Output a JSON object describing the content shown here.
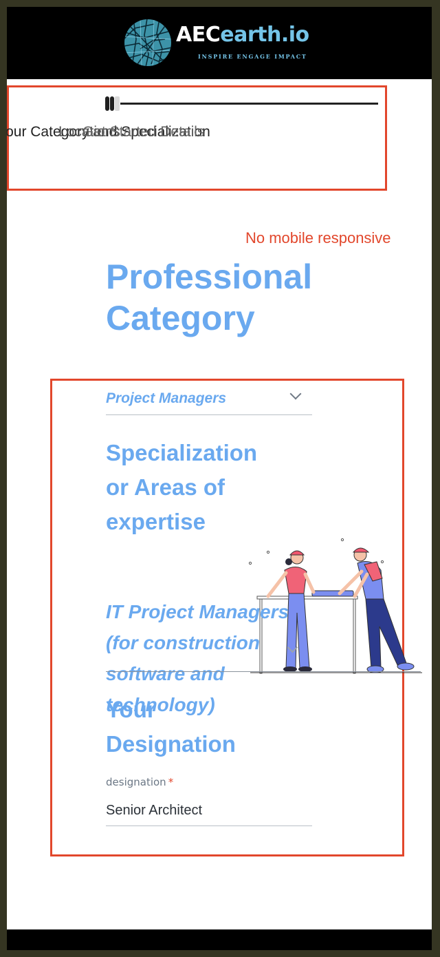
{
  "header": {
    "logo": {
      "name_part1": "AEC",
      "name_part2": "earth.io",
      "tagline": "INSPIRE ENGAGE IMPACT",
      "icon": "globe-map-icon"
    }
  },
  "steps": {
    "labels": [
      "Your Category and Specialization",
      "Locations",
      "Get Started Details"
    ]
  },
  "annotation": {
    "note": "No mobile responsive",
    "color": "#e2472c"
  },
  "form": {
    "title": "Professional Category",
    "category": {
      "selected": "Project Managers"
    },
    "specialization": {
      "heading": "Specialization or Areas of expertise",
      "selected": "IT Project Managers (for construction software and technology)"
    },
    "designation": {
      "heading": "Your Designation",
      "label": "designation",
      "required_mark": "*",
      "value": "Senior Architect"
    }
  },
  "illustration": {
    "icon": "construction-workers-illustration"
  },
  "colors": {
    "accent": "#6aa9ef",
    "logo_blue": "#74c4e8",
    "annotation_red": "#e2472c"
  }
}
